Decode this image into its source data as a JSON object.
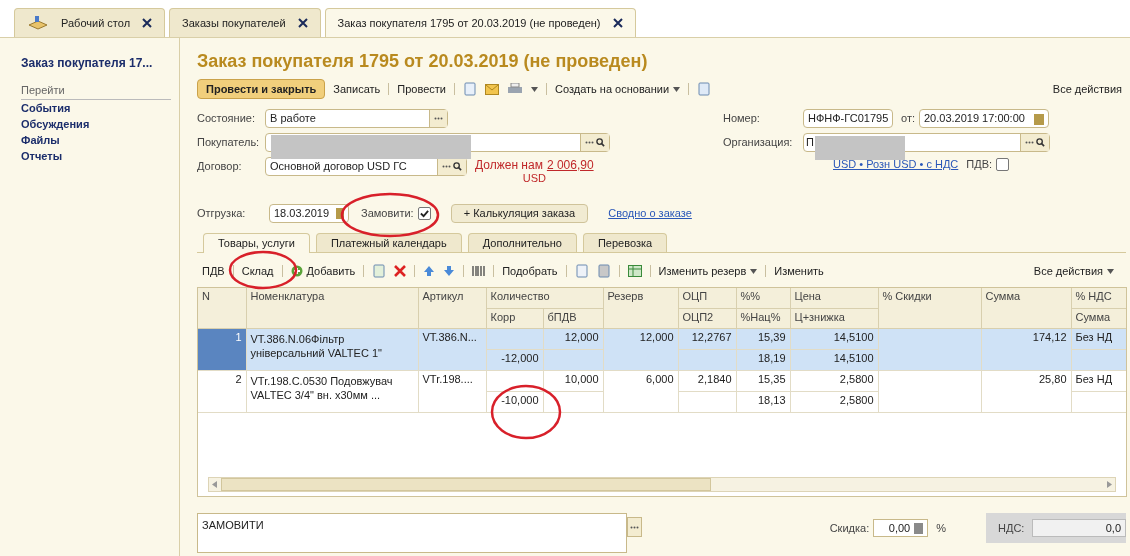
{
  "tabs": [
    {
      "label": "Рабочий стол",
      "selected": false,
      "kind": "home"
    },
    {
      "label": "Заказы покупателей",
      "selected": false,
      "kind": "plain"
    },
    {
      "label": "Заказ покупателя 1795 от 20.03.2019 (не проведен)",
      "selected": true,
      "kind": "plain"
    }
  ],
  "sidebar": {
    "title": "Заказ покупателя 17...",
    "section": "Перейти",
    "items": [
      "События",
      "Обсуждения",
      "Файлы",
      "Отчеты"
    ]
  },
  "form": {
    "title": "Заказ покупателя 1795 от 20.03.2019 (не проведен)",
    "toolbar": {
      "primary": "Провести и закрыть",
      "buttons": [
        "Записать",
        "Провести"
      ],
      "create_based": "Создать на основании",
      "all_actions": "Все действия"
    },
    "state": {
      "label": "Состояние:",
      "value": "В работе"
    },
    "customer": {
      "label": "Покупатель:"
    },
    "contract": {
      "label": "Договор:",
      "value": "Основной договор USD ГС"
    },
    "debt": {
      "text": "Должен нам",
      "amount": "2 006,90",
      "currency": "USD"
    },
    "number": {
      "label": "Номер:",
      "value": "НФНФ-ГС01795",
      "date_label": "от:",
      "date": "20.03.2019 17:00:00"
    },
    "organization": {
      "label": "Организация:",
      "value": "П"
    },
    "price_link": "USD • Розн USD • с НДС",
    "vat": {
      "label": "ПДВ:",
      "checked": false
    },
    "shipment": {
      "label": "Отгрузка:",
      "value": "18.03.2019"
    },
    "order": {
      "label": "Замовити:",
      "checked": true
    },
    "calc_button": "+ Калькуляция заказа",
    "summary_link": "Сводно о заказе"
  },
  "section_tabs": [
    {
      "label": "Товары, услуги",
      "selected": true
    },
    {
      "label": "Платежный календарь",
      "selected": false
    },
    {
      "label": "Дополнительно",
      "selected": false
    },
    {
      "label": "Перевозка",
      "selected": false
    }
  ],
  "table_toolbar": {
    "vat": "ПДВ",
    "warehouse": "Склад",
    "add": "Добавить",
    "pick": "Подобрать",
    "change_reserve": "Изменить резерв",
    "change": "Изменить",
    "all_actions": "Все действия"
  },
  "table": {
    "columns": {
      "number": "N",
      "nomenclature": "Номенклатура",
      "article": "Артикул",
      "quantity": "Количество",
      "korr": "Корр",
      "bpdv": "бПДВ",
      "reserve": "Резерв",
      "ocp": "ОЦП",
      "ocp2": "ОЦП2",
      "pct": "%%",
      "markup": "%Нац%",
      "price": "Цена",
      "price_discount": "Ц+знижка",
      "discount": "% Скидки",
      "sum": "Сумма",
      "vat_rate": "% НДС",
      "vat_sum": "Сумма"
    },
    "rows": [
      {
        "number": "1",
        "selected": true,
        "nomenclature": "VT.386.N.06Фільтр універсальний VALTEC 1\"",
        "article": "VT.386.N...",
        "bpdv": "12,000",
        "korr": "-12,000",
        "reserve": "12,000",
        "ocp": "12,2767",
        "pct": "15,39",
        "markup": "18,19",
        "price": "14,5100",
        "price_discount": "14,5100",
        "sum": "174,12",
        "vat_rate": "Без НД"
      },
      {
        "number": "2",
        "selected": false,
        "nomenclature": "VTr.198.C.0530 Подовжувач VALTEC 3/4\" вн. x30мм ...",
        "article": "VTr.198....",
        "bpdv": "10,000",
        "korr": "-10,000",
        "reserve": "6,000",
        "ocp": "2,1840",
        "pct": "15,35",
        "markup": "18,13",
        "price": "2,5800",
        "price_discount": "2,5800",
        "sum": "25,80",
        "vat_rate": "Без НД"
      }
    ]
  },
  "comment": {
    "value": "ЗАМОВИТИ"
  },
  "discount": {
    "label": "Скидка:",
    "value": "0,00",
    "unit": "%"
  },
  "vat_total": {
    "label": "НДС:",
    "value": "0,0"
  }
}
